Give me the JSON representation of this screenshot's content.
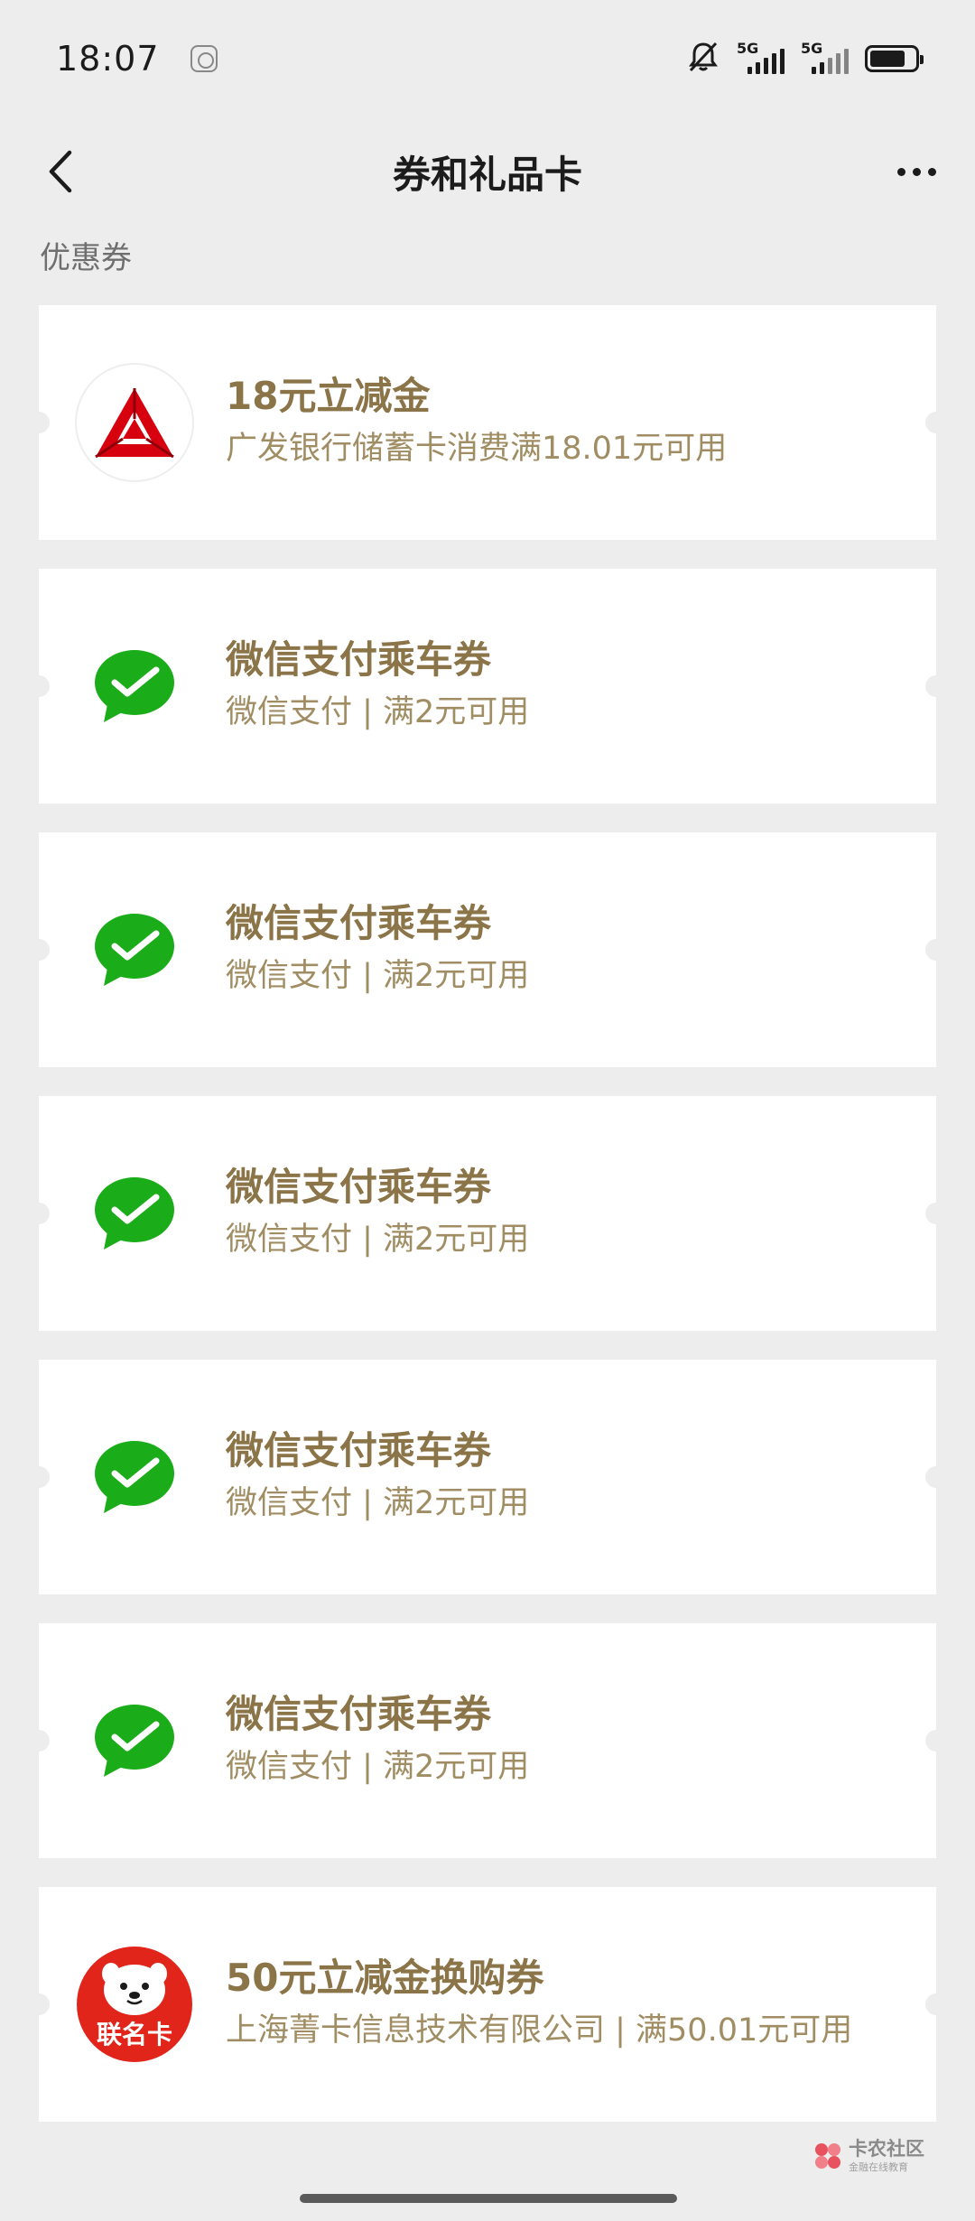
{
  "status_bar": {
    "time": "18:07",
    "icons": [
      "gallery-app-icon",
      "mute-bell-icon",
      "signal-5g-icon",
      "signal-5g-icon",
      "battery-icon"
    ],
    "network_1": "5G",
    "network_2": "5G",
    "battery_level": 0.8
  },
  "nav": {
    "back_icon": "chevron-left-icon",
    "title": "券和礼品卡",
    "more_icon": "more-dots-icon"
  },
  "section": {
    "title": "优惠券"
  },
  "coupons": [
    {
      "logo": "cgb-bank-logo",
      "title": "18元立减金",
      "desc": "广发银行储蓄卡消费满18.01元可用"
    },
    {
      "logo": "wechat-pay-logo",
      "title": "微信支付乘车券",
      "desc": "微信支付 | 满2元可用"
    },
    {
      "logo": "wechat-pay-logo",
      "title": "微信支付乘车券",
      "desc": "微信支付 | 满2元可用"
    },
    {
      "logo": "wechat-pay-logo",
      "title": "微信支付乘车券",
      "desc": "微信支付 | 满2元可用"
    },
    {
      "logo": "wechat-pay-logo",
      "title": "微信支付乘车券",
      "desc": "微信支付 | 满2元可用"
    },
    {
      "logo": "wechat-pay-logo",
      "title": "微信支付乘车券",
      "desc": "微信支付 | 满2元可用"
    },
    {
      "logo": "jd-co-brand-card-logo",
      "logo_text": "联名卡",
      "title": "50元立减金换购券",
      "desc": "上海菁卡信息技术有限公司 | 满50.01元可用"
    }
  ],
  "watermark": {
    "title": "卡农社区",
    "subtitle": "金融在线教育"
  },
  "colors": {
    "background": "#ededed",
    "card": "#ffffff",
    "coupon_title": "#8a7448",
    "coupon_desc": "#a08d63",
    "wechat_green": "#1aad19",
    "bank_red": "#d7000f"
  }
}
